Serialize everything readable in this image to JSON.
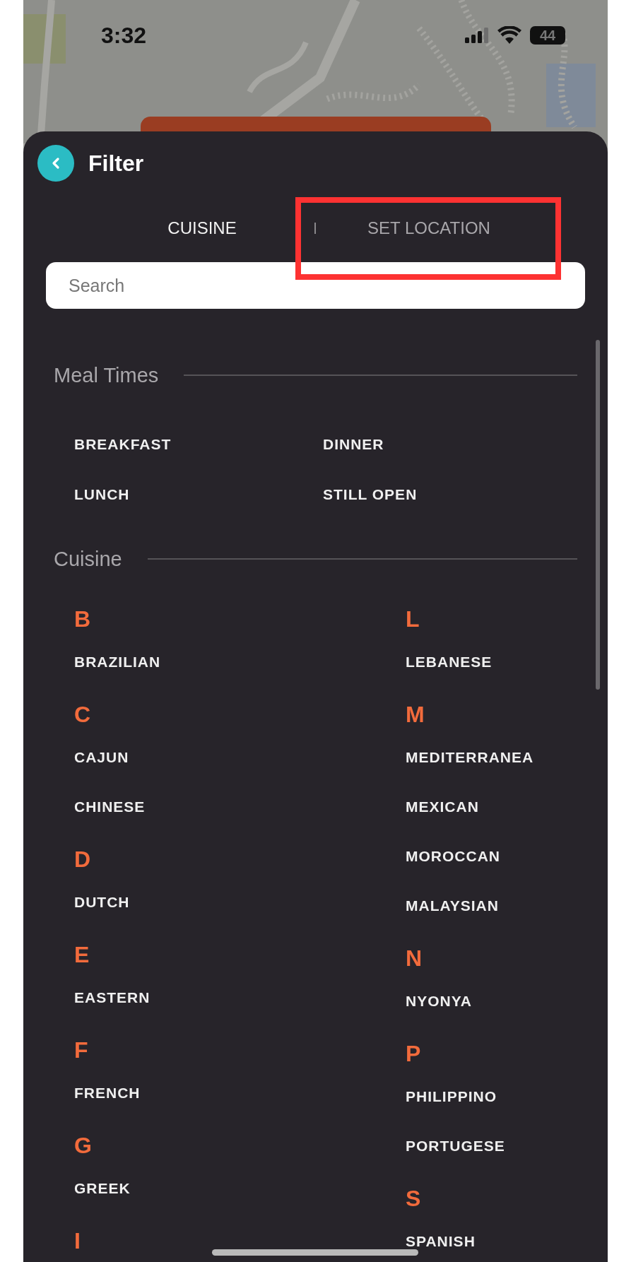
{
  "status_bar": {
    "time": "3:32",
    "battery": "44"
  },
  "panel": {
    "title": "Filter"
  },
  "tabs": [
    {
      "label": "CUISINE",
      "selected": true
    },
    {
      "label": "SET LOCATION",
      "selected": false
    }
  ],
  "search": {
    "placeholder": "Search"
  },
  "meal_times": {
    "heading": "Meal Times",
    "options": [
      "BREAKFAST",
      "DINNER",
      "LUNCH",
      "STILL OPEN"
    ]
  },
  "cuisine": {
    "heading": "Cuisine",
    "columns": [
      [
        {
          "letter": "B",
          "items": [
            "BRAZILIAN"
          ]
        },
        {
          "letter": "C",
          "items": [
            "CAJUN",
            "CHINESE"
          ]
        },
        {
          "letter": "D",
          "items": [
            "DUTCH"
          ]
        },
        {
          "letter": "E",
          "items": [
            "EASTERN"
          ]
        },
        {
          "letter": "F",
          "items": [
            "FRENCH"
          ]
        },
        {
          "letter": "G",
          "items": [
            "GREEK"
          ]
        },
        {
          "letter": "I"
        }
      ],
      [
        {
          "letter": "L",
          "items": [
            "LEBANESE"
          ]
        },
        {
          "letter": "M",
          "items": [
            "MEDITERRANEA",
            "MEXICAN",
            "MOROCCAN",
            "MALAYSIAN"
          ]
        },
        {
          "letter": "N",
          "items": [
            "NYONYA"
          ]
        },
        {
          "letter": "P",
          "items": [
            "PHILIPPINO",
            "PORTUGESE"
          ]
        },
        {
          "letter": "S",
          "items": [
            "SPANISH"
          ]
        }
      ]
    ]
  }
}
